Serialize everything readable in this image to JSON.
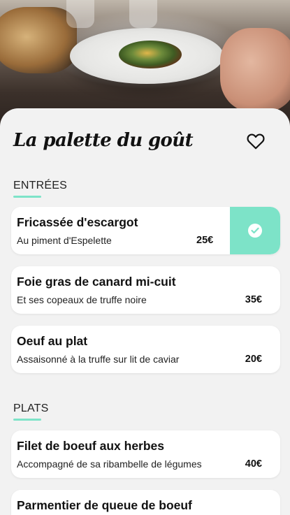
{
  "restaurant": {
    "title": "La palette du goût"
  },
  "icons": {
    "favorite": "heart-outline-icon",
    "select": "check-circle-icon"
  },
  "colors": {
    "accent": "#7de3c8",
    "background": "#f2f2f2",
    "card": "#ffffff"
  },
  "sections": [
    {
      "label": "ENTRÉES",
      "items": [
        {
          "name": "Fricassée d'escargot",
          "description": "Au piment d'Espelette",
          "price": "25€",
          "selected": true
        },
        {
          "name": "Foie gras de canard mi-cuit",
          "description": "Et ses copeaux de truffe noire",
          "price": "35€",
          "selected": false
        },
        {
          "name": "Oeuf au plat",
          "description": "Assaisonné à la truffe sur lit de caviar",
          "price": "20€",
          "selected": false
        }
      ]
    },
    {
      "label": "PLATS",
      "items": [
        {
          "name": "Filet de boeuf aux herbes",
          "description": "Accompagné de sa ribambelle de légumes",
          "price": "40€",
          "selected": false
        },
        {
          "name": "Parmentier de queue de boeuf",
          "description": "",
          "price": "",
          "selected": false
        }
      ]
    }
  ]
}
